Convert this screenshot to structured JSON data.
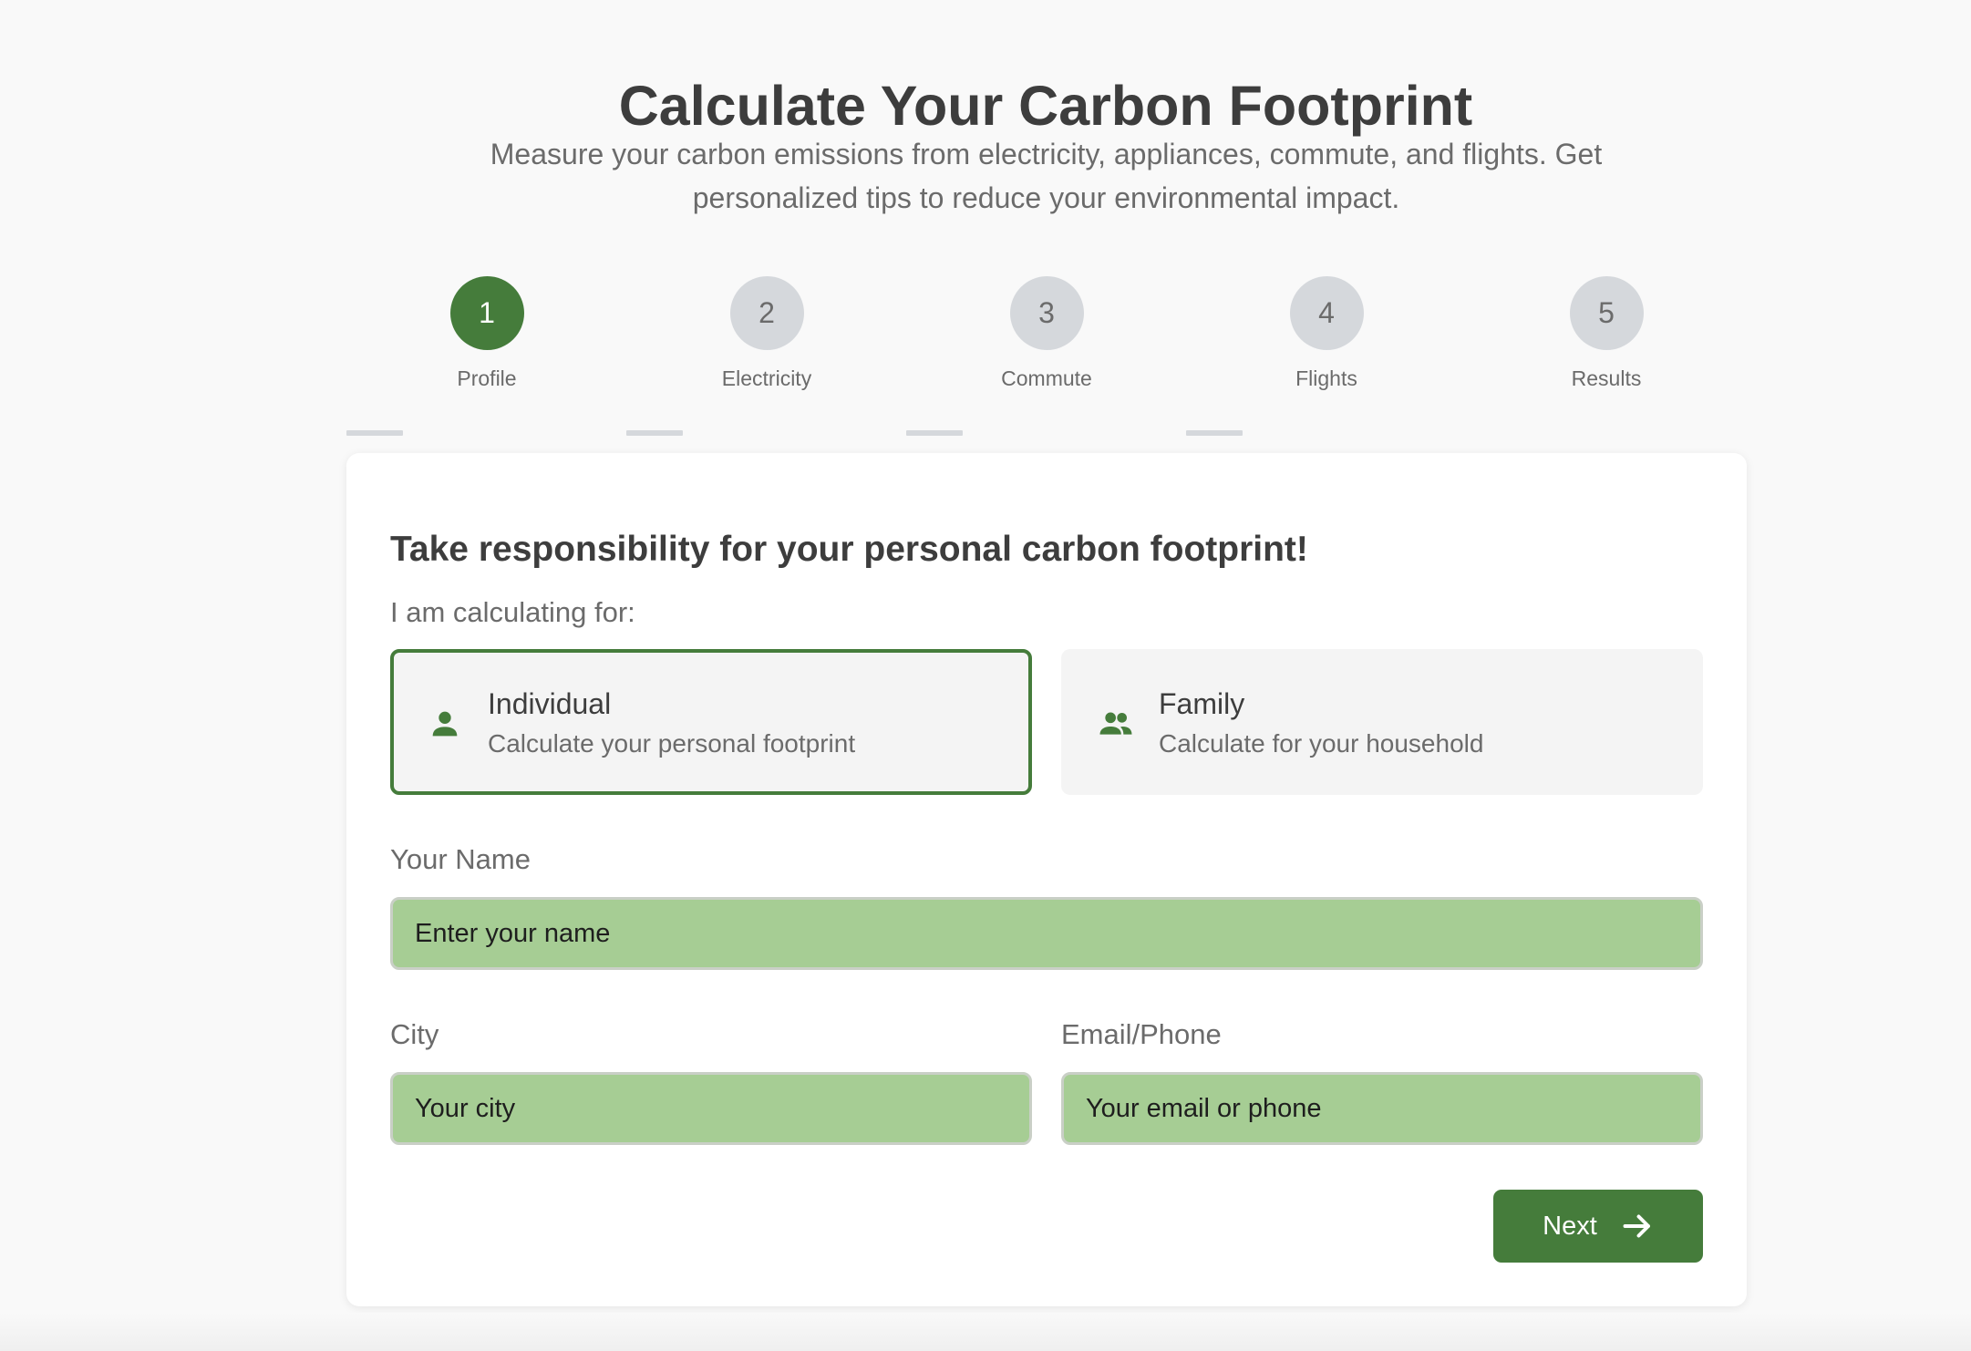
{
  "header": {
    "title": "Calculate Your Carbon Footprint",
    "subtitle": "Measure your carbon emissions from electricity, appliances, commute, and flights. Get personalized tips to reduce your environmental impact."
  },
  "steps": [
    {
      "number": "1",
      "label": "Profile",
      "active": true
    },
    {
      "number": "2",
      "label": "Electricity",
      "active": false
    },
    {
      "number": "3",
      "label": "Commute",
      "active": false
    },
    {
      "number": "4",
      "label": "Flights",
      "active": false
    },
    {
      "number": "5",
      "label": "Results",
      "active": false
    }
  ],
  "card": {
    "heading": "Take responsibility for your personal carbon footprint!",
    "calculating_for_label": "I am calculating for:",
    "options": [
      {
        "title": "Individual",
        "description": "Calculate your personal footprint",
        "icon": "person-icon",
        "selected": true
      },
      {
        "title": "Family",
        "description": "Calculate for your household",
        "icon": "group-icon",
        "selected": false
      }
    ],
    "name_field": {
      "label": "Your Name",
      "placeholder": "Enter your name",
      "value": ""
    },
    "city_field": {
      "label": "City",
      "placeholder": "Your city",
      "value": ""
    },
    "contact_field": {
      "label": "Email/Phone",
      "placeholder": "Your email or phone",
      "value": ""
    },
    "next_button": {
      "label": "Next",
      "icon": "arrow-right-icon"
    }
  },
  "colors": {
    "accent": "#457c3b",
    "input_bg": "#a6cd94",
    "inactive_step": "#d5d8dc",
    "text": "#3d3d3d",
    "muted_text": "#6b6b6b"
  }
}
